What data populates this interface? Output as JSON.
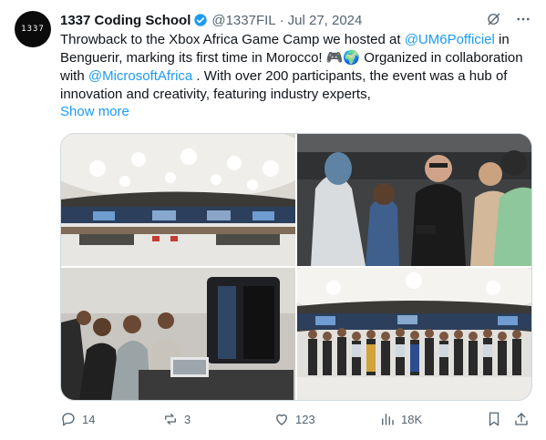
{
  "author": {
    "avatar_text": "1337",
    "name": "1337 Coding School",
    "handle": "@1337FIL",
    "separator": "·",
    "date": "Jul 27, 2024"
  },
  "tweet": {
    "t1": "Throwback to the Xbox Africa Game Camp we hosted at ",
    "mention1": "@UM6Pofficiel",
    "t2": " in Benguerir, marking its first time in Morocco! 🎮🌍 Organized in collaboration with ",
    "mention2": "@MicrosoftAfrica",
    "t3": " . With over 200 participants, the event was a hub of innovation and creativity, featuring industry experts,",
    "show_more": "Show more"
  },
  "media": {
    "photo_descriptions": [
      "auditorium",
      "people-talking",
      "game-booth",
      "group-photo"
    ]
  },
  "actions": {
    "replies": "14",
    "reposts": "3",
    "likes": "123",
    "views": "18K"
  },
  "colors": {
    "accent": "#1d9bf0",
    "muted": "#536471",
    "text": "#0f1419",
    "border": "#cfd9de"
  },
  "icons": [
    "verified-badge-icon",
    "grok-icon",
    "more-icon",
    "reply-icon",
    "repost-icon",
    "like-icon",
    "views-icon",
    "bookmark-icon",
    "share-icon"
  ]
}
